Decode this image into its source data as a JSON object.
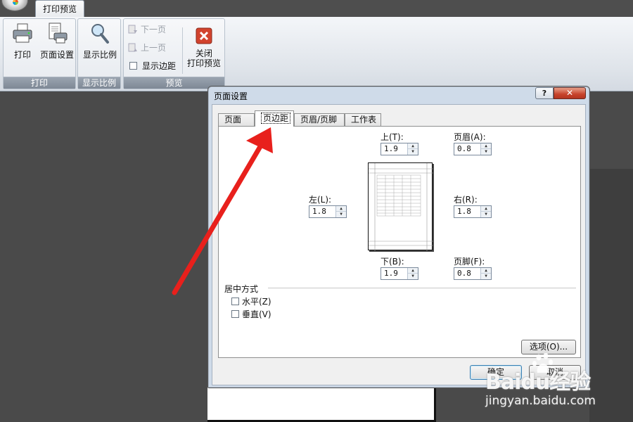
{
  "ribbon": {
    "tab_label": "打印预览",
    "groups": {
      "print": {
        "label": "打印",
        "print_button": "打印",
        "page_setup_button": "页面设置"
      },
      "zoom": {
        "label": "显示比例",
        "zoom_button": "显示比例"
      },
      "preview": {
        "label": "预览",
        "next_page": "下一页",
        "prev_page": "上一页",
        "show_margins": "显示边距",
        "close_line1": "关闭",
        "close_line2": "打印预览"
      }
    }
  },
  "dialog": {
    "title": "页面设置",
    "help": "?",
    "close": "✕",
    "tabs": [
      {
        "label": "页面"
      },
      {
        "label": "页边距",
        "active": true
      },
      {
        "label": "页眉/页脚"
      },
      {
        "label": "工作表"
      }
    ],
    "margins": {
      "top": {
        "label": "上(T):",
        "value": "1.9"
      },
      "header": {
        "label": "页眉(A):",
        "value": "0.8"
      },
      "left": {
        "label": "左(L):",
        "value": "1.8"
      },
      "right": {
        "label": "右(R):",
        "value": "1.8"
      },
      "bottom": {
        "label": "下(B):",
        "value": "1.9"
      },
      "footer": {
        "label": "页脚(F):",
        "value": "0.8"
      }
    },
    "center_group": {
      "title": "居中方式",
      "horizontal": "水平(Z)",
      "vertical": "垂直(V)"
    },
    "options_button": "选项(O)...",
    "ok_button": "确定",
    "cancel_button": "取消"
  },
  "watermark": {
    "main": "Baidu经验",
    "sub": "jingyan.baidu.com"
  },
  "colors": {
    "arrow": "#e8201c",
    "close_red": "#c7432b"
  }
}
